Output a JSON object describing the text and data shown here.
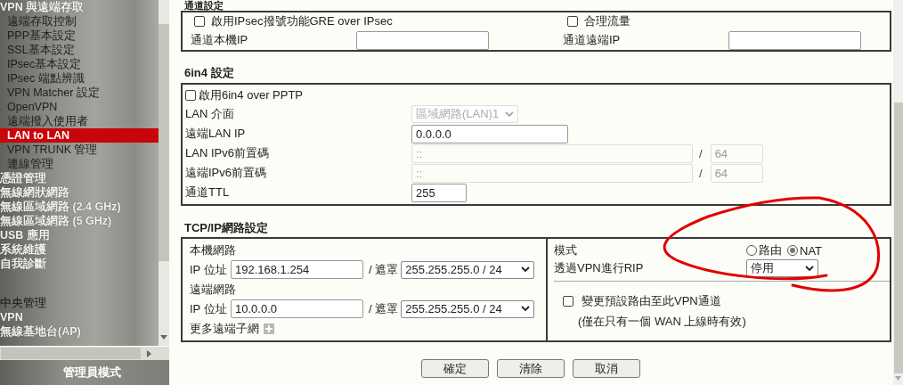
{
  "sidebar": {
    "items": [
      {
        "label": "VPN 與遠端存取",
        "kind": "group",
        "selected": false,
        "children": [
          {
            "label": "遠端存取控制",
            "selected": false
          },
          {
            "label": "PPP基本設定",
            "selected": false
          },
          {
            "label": "SSL基本設定",
            "selected": false
          },
          {
            "label": "IPsec基本設定",
            "selected": false
          },
          {
            "label": "IPsec 端點辨識",
            "selected": false
          },
          {
            "label": "VPN Matcher 設定",
            "selected": false
          },
          {
            "label": "OpenVPN",
            "selected": false
          },
          {
            "label": "遠端撥入使用者",
            "selected": false
          },
          {
            "label": "LAN to LAN",
            "selected": true
          },
          {
            "label": "VPN TRUNK 管理",
            "selected": false
          },
          {
            "label": "連線管理",
            "selected": false
          }
        ]
      },
      {
        "label": "憑證管理",
        "kind": "group",
        "selected": false
      },
      {
        "label": "無線網狀網路",
        "kind": "group",
        "selected": false
      },
      {
        "label": "無線區域網路 (2.4 GHz)",
        "kind": "group",
        "selected": false
      },
      {
        "label": "無線區域網路 (5 GHz)",
        "kind": "group",
        "selected": false
      },
      {
        "label": "USB 應用",
        "kind": "group",
        "selected": false
      },
      {
        "label": "系統維護",
        "kind": "group",
        "selected": false
      },
      {
        "label": "自我診斷",
        "kind": "group",
        "selected": false
      },
      {
        "label": "中央管理",
        "kind": "section",
        "selected": false
      },
      {
        "label": "VPN",
        "kind": "group",
        "selected": false
      },
      {
        "label": "無線基地台(AP)",
        "kind": "group",
        "selected": false
      }
    ],
    "footer": "管理員模式"
  },
  "tunnel": {
    "title": "通道設定",
    "gre": {
      "label": "啟用IPsec撥號功能GRE over IPsec",
      "checked": false
    },
    "fair_traffic": {
      "label": "合理流量",
      "checked": false
    },
    "local_ip": {
      "label": "通道本機IP"
    },
    "remote_ip": {
      "label": "通道遠端IP"
    }
  },
  "six_in_four": {
    "title": "6in4 設定",
    "enable": {
      "label": "啟用6in4 over PPTP",
      "checked": false
    },
    "rows": [
      {
        "kind": "select",
        "label": "LAN 介面",
        "value": "區域網路(LAN)1",
        "disabled": true
      },
      {
        "kind": "text",
        "label": "遠端LAN IP",
        "value": "0.0.0.0",
        "disabled": false
      },
      {
        "kind": "prefix",
        "label": "LAN IPv6前置碼",
        "value": "::",
        "separator": "/",
        "length": "64",
        "disabled": true
      },
      {
        "kind": "prefix",
        "label": "遠端IPv6前置碼",
        "value": "::",
        "separator": "/",
        "length": "64",
        "disabled": true
      },
      {
        "kind": "short",
        "label": "通道TTL",
        "value": "255",
        "disabled": false
      }
    ]
  },
  "tcpip": {
    "title": "TCP/IP網路設定",
    "networks": [
      {
        "heading": "本機網路",
        "ip_label": "IP 位址",
        "ip": "192.168.1.254",
        "mask_label": "/ 遮罩",
        "mask": "255.255.255.0 / 24"
      },
      {
        "heading": "遠端網路",
        "ip_label": "IP 位址",
        "ip": "10.0.0.0",
        "mask_label": "/ 遮罩",
        "mask": "255.255.255.0 / 24"
      }
    ],
    "more_subnets": "更多遠端子網",
    "mode": {
      "label": "模式",
      "options": [
        {
          "label": "路由",
          "selected": false
        },
        {
          "label": "NAT",
          "selected": true
        }
      ]
    },
    "rip": {
      "label": "透過VPN進行RIP",
      "value": "停用"
    },
    "default_route": {
      "label": "變更預設路由至此VPN通道",
      "checked": false,
      "note": "(僅在只有一個 WAN 上線時有效)"
    }
  },
  "buttons": [
    {
      "label": "確定"
    },
    {
      "label": "清除"
    },
    {
      "label": "取消"
    }
  ]
}
